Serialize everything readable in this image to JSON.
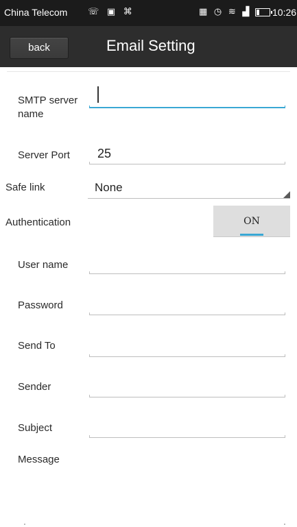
{
  "statusbar": {
    "carrier": "China Telecom",
    "left_icons": "☏ ▣ ⌘",
    "right_icons": "▦ ◷ ≋ ▟",
    "time": "10:26"
  },
  "appbar": {
    "back_label": "back",
    "title": "Email Setting"
  },
  "form": {
    "smtp_label": "SMTP server name",
    "smtp_value": "",
    "port_label": "Server Port",
    "port_value": "25",
    "safe_link_label": "Safe link",
    "safe_link_value": "None",
    "auth_label": "Authentication",
    "auth_toggle": "ON",
    "user_label": "User name",
    "user_value": "",
    "password_label": "Password",
    "password_value": "",
    "send_to_label": "Send To",
    "send_to_value": "",
    "sender_label": "Sender",
    "sender_value": "",
    "subject_label": "Subject",
    "subject_value": "",
    "message_label": "Message",
    "message_value": ""
  },
  "colors": {
    "accent": "#39a7d4",
    "statusbar_bg": "#1b1b1b",
    "appbar_bg": "#2d2d2d"
  },
  "icons": [
    "wechat-icon",
    "image-icon",
    "notification-icon",
    "nfc-icon",
    "alarm-icon",
    "wifi-icon",
    "signal-icon",
    "battery-icon"
  ]
}
